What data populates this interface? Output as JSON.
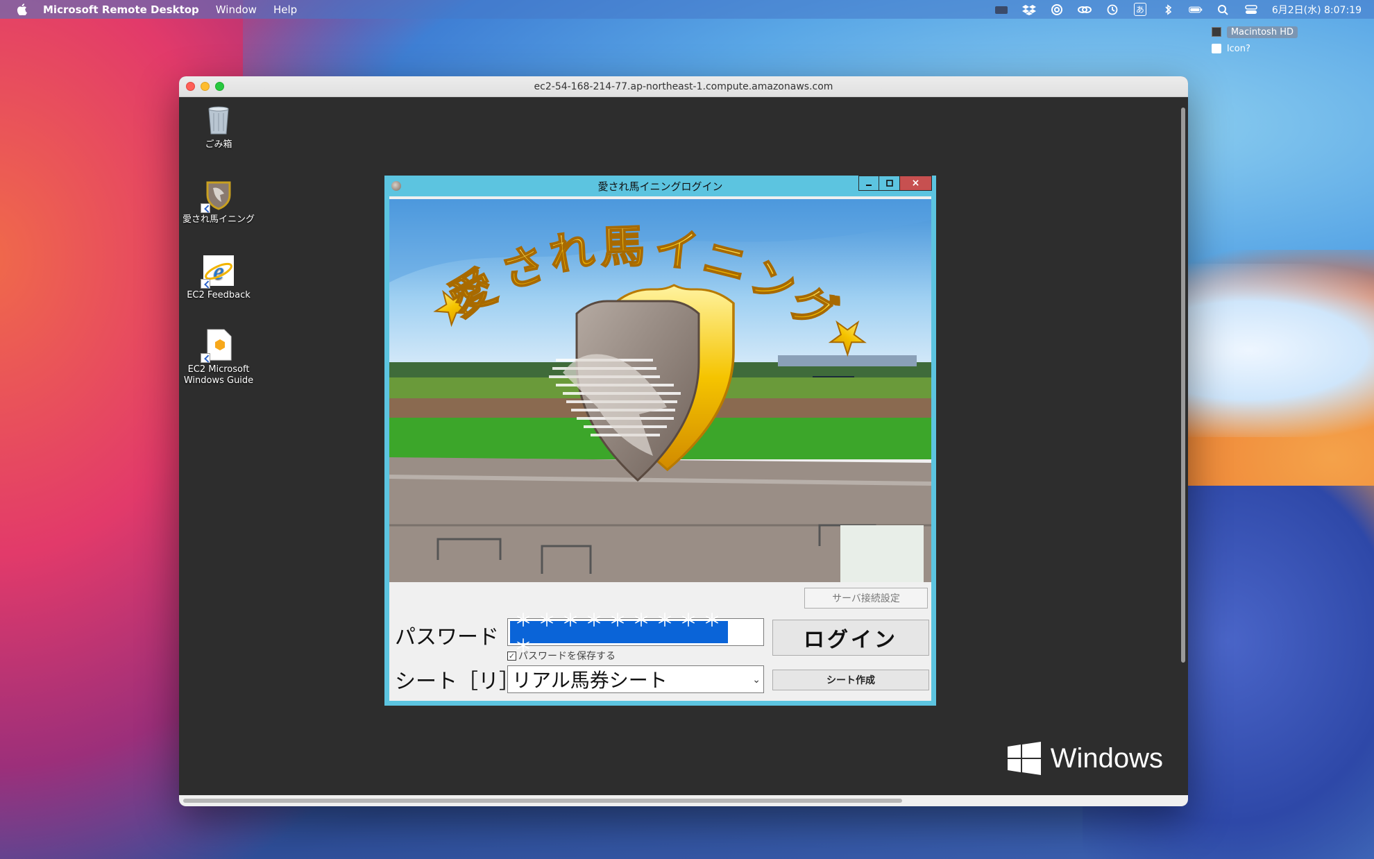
{
  "menubar": {
    "app_name": "Microsoft Remote Desktop",
    "menu_items": [
      "Window",
      "Help"
    ],
    "clock": "6月2日(水) 8:07:19",
    "input_method": "あ"
  },
  "mac_desktop": {
    "items": [
      "Macintosh HD",
      "Icon?"
    ]
  },
  "rd_window": {
    "title": "ec2-54-168-214-77.ap-northeast-1.compute.amazonaws.com"
  },
  "windows_desktop": {
    "icons": [
      "ごみ箱",
      "愛され馬イニング",
      "EC2 Feedback",
      "EC2 Microsoft Windows Guide"
    ],
    "logo_text": "Windows"
  },
  "login_dialog": {
    "title": "愛され馬イニングログイン",
    "banner_text": "★愛され馬イニング★",
    "server_settings_button": "サーバ接続設定",
    "password_label": "パスワード",
    "password_value": "＊＊＊＊＊＊＊＊＊＊",
    "login_button": "ログイン",
    "save_password_label": "パスワードを保存する",
    "save_password_checked": true,
    "sheet_label": "シート［リ］",
    "sheet_selected": "リアル馬券シート",
    "create_sheet_button": "シート作成",
    "close_glyph": "×"
  },
  "colors": {
    "dialog_frame": "#5cc4e0",
    "selection": "#0a64d8",
    "close_button": "#c75050"
  }
}
